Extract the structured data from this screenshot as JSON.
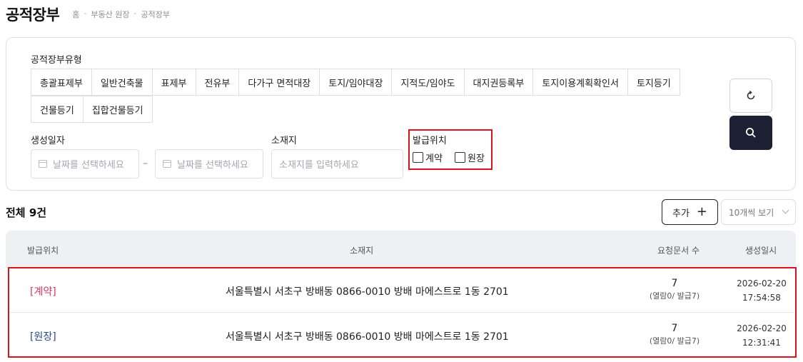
{
  "page": {
    "title": "공적장부",
    "breadcrumb": [
      "홈",
      "부동산 원장",
      "공적장부"
    ],
    "breadcrumb_sep": "-"
  },
  "filter": {
    "type_label": "공적장부유형",
    "types_row1": [
      "총괄표제부",
      "일반건축물",
      "표제부",
      "전유부",
      "다가구 면적대장",
      "토지/임야대장",
      "지적도/임야도",
      "대지권등록부",
      "토지이용계획확인서",
      "토지등기"
    ],
    "types_row2": [
      "건물등기",
      "집합건물등기"
    ],
    "date_label": "생성일자",
    "date_from_placeholder": "날짜를 선택하세요",
    "date_to_placeholder": "날짜를 선택하세요",
    "date_separator": "–",
    "location_label": "소재지",
    "location_placeholder": "소재지를 입력하세요",
    "issue_label": "발급위치",
    "issue_options": [
      "계약",
      "원장"
    ],
    "reset_icon": "refresh-icon",
    "search_icon": "search-icon"
  },
  "list": {
    "total_label": "전체 9건",
    "add_label": "추가",
    "page_size": "10개씩 보기",
    "columns": [
      "발급위치",
      "소재지",
      "요청문서 수",
      "생성일시"
    ],
    "rows": [
      {
        "kind": "[계약]",
        "address": "서울특별시 서초구 방배동 0866-0010 방배 마에스트로 1동 2701",
        "count": "7",
        "count_detail": "(열람0/ 발급7)",
        "date": "2026-02-20",
        "time": "17:54:58"
      },
      {
        "kind": "[원장]",
        "address": "서울특별시 서초구 방배동 0866-0010 방배 마에스트로 1동 2701",
        "count": "7",
        "count_detail": "(열람0/ 발급7)",
        "date": "2026-02-20",
        "time": "12:31:41"
      }
    ]
  },
  "colors": {
    "accent_dark": "#1b2133",
    "highlight_red": "#d9151b",
    "contract_pink": "#e0325c",
    "ledger_blue": "#2a4a8a"
  }
}
